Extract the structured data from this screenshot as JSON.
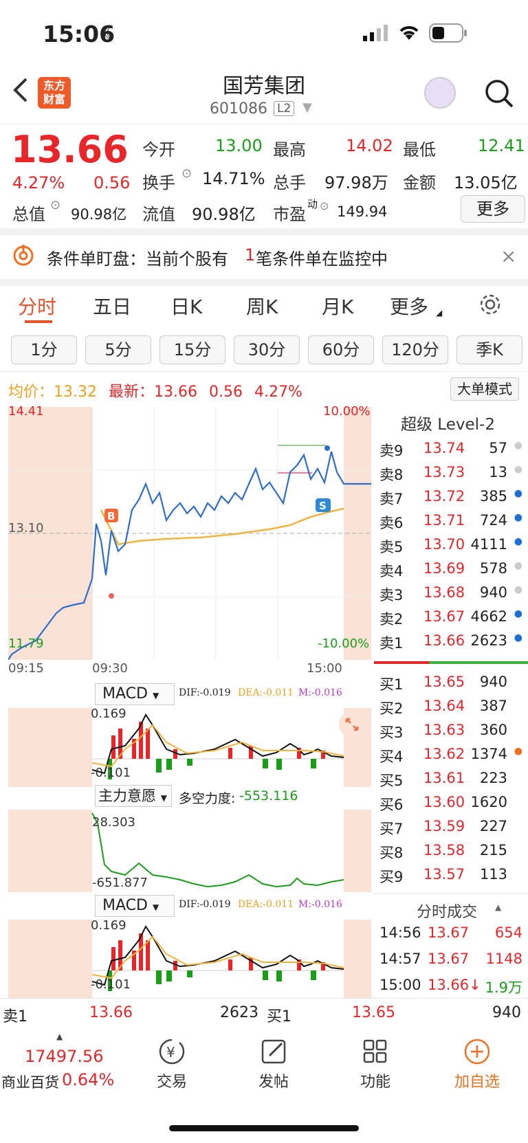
{
  "status": {
    "time": "15:06"
  },
  "header": {
    "title": "国芳集团",
    "code": "601086",
    "level": "L2",
    "logo": "东方\n财富"
  },
  "quote": {
    "price": "13.66",
    "change_pct": "4.27%",
    "change": "0.56",
    "open_label": "今开",
    "open": "13.00",
    "high_label": "最高",
    "high": "14.02",
    "low_label": "最低",
    "low": "12.41",
    "turnover_label": "换手",
    "turnover": "14.71%",
    "volume_label": "总手",
    "volume": "97.98万",
    "amount_label": "金额",
    "amount": "13.05亿",
    "mktcap_label": "总值",
    "mktcap": "90.98亿",
    "float_label": "流值",
    "float": "90.98亿",
    "pe_label": "市盈",
    "pe_sup": "动",
    "pe": "149.94",
    "more": "更多"
  },
  "condition": {
    "text_a": "条件单盯盘：当前个股有",
    "count": "1",
    "text_b": "笔条件单在监控中"
  },
  "tabs": [
    "分时",
    "五日",
    "日K",
    "周K",
    "月K",
    "更多"
  ],
  "minute_buttons": [
    "1分",
    "5分",
    "15分",
    "30分",
    "60分",
    "120分",
    "季K"
  ],
  "info_line": {
    "avg_label": "均价：",
    "avg": "13.32",
    "latest_label": "最新：",
    "latest": "13.66",
    "chg": "0.56",
    "pct": "4.27%"
  },
  "big_mode": "大单模式",
  "chart_labels": {
    "top": "14.41",
    "mid": "13.10",
    "bottom": "11.79",
    "top_pct": "10.00%",
    "bottom_pct": "-10.00%",
    "t1": "09:15",
    "t2": "09:30",
    "t3": "15:00"
  },
  "macd": {
    "name": "MACD",
    "dif": "DIF:-0.019",
    "dea": "DEA:-0.011",
    "m": "M:-0.016",
    "hi": "0.169",
    "lo": "-0.101"
  },
  "zhuli": {
    "name": "主力意愿",
    "label": "多空力度:",
    "value": "-553.116",
    "hi": "28.303",
    "lo": "-651.877"
  },
  "orderbook": {
    "title": "超级 Level-2",
    "sell": [
      {
        "label": "卖9",
        "price": "13.74",
        "vol": "57"
      },
      {
        "label": "卖8",
        "price": "13.73",
        "vol": "13"
      },
      {
        "label": "卖7",
        "price": "13.72",
        "vol": "385"
      },
      {
        "label": "卖6",
        "price": "13.71",
        "vol": "724"
      },
      {
        "label": "卖5",
        "price": "13.70",
        "vol": "4111"
      },
      {
        "label": "卖4",
        "price": "13.69",
        "vol": "578"
      },
      {
        "label": "卖3",
        "price": "13.68",
        "vol": "940"
      },
      {
        "label": "卖2",
        "price": "13.67",
        "vol": "4662"
      },
      {
        "label": "卖1",
        "price": "13.66",
        "vol": "2623"
      }
    ],
    "buy": [
      {
        "label": "买1",
        "price": "13.65",
        "vol": "940"
      },
      {
        "label": "买2",
        "price": "13.64",
        "vol": "387"
      },
      {
        "label": "买3",
        "price": "13.63",
        "vol": "360"
      },
      {
        "label": "买4",
        "price": "13.62",
        "vol": "1374"
      },
      {
        "label": "买5",
        "price": "13.61",
        "vol": "223"
      },
      {
        "label": "买6",
        "price": "13.60",
        "vol": "1620"
      },
      {
        "label": "买7",
        "price": "13.59",
        "vol": "227"
      },
      {
        "label": "买8",
        "price": "13.58",
        "vol": "215"
      },
      {
        "label": "买9",
        "price": "13.57",
        "vol": "113"
      }
    ]
  },
  "ticks": {
    "title": "分时成交",
    "rows": [
      {
        "t": "14:56",
        "p": "13.67",
        "v": "654"
      },
      {
        "t": "14:57",
        "p": "13.67",
        "v": "1148"
      },
      {
        "t": "15:00",
        "p": "13.66↓",
        "v": "1.9万"
      }
    ]
  },
  "bottom_quote": {
    "sell_label": "卖1",
    "sell_price": "13.66",
    "sell_vol": "2623",
    "buy_label": "买1",
    "buy_price": "13.65",
    "buy_vol": "940"
  },
  "index": {
    "value": "17497.56",
    "name": "商业百货",
    "pct": "0.64%"
  },
  "nav": [
    "交易",
    "发帖",
    "功能",
    "加自选"
  ]
}
